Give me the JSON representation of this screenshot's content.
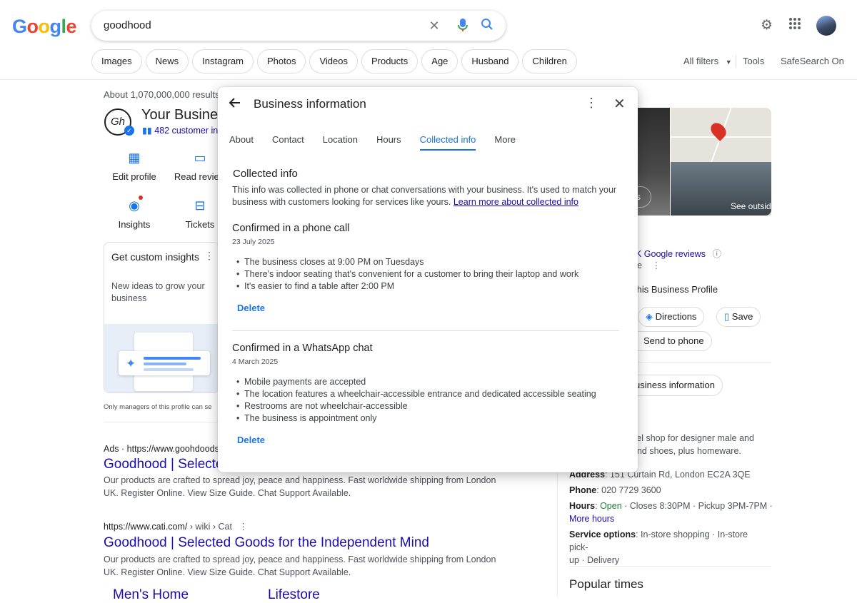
{
  "brand": {
    "logo": "Google",
    "colors": {
      "blue": "#4285F4",
      "red": "#EA4335",
      "yellow": "#FBBC05",
      "green": "#34A853",
      "link": "#1a0dab",
      "accent": "#1a73e8"
    }
  },
  "search": {
    "query": "goodhood"
  },
  "icons": {
    "clear": "close-icon",
    "voice": "mic-icon",
    "search": "search-icon",
    "settings": "gear-icon",
    "apps": "apps-grid-icon"
  },
  "filter_chips": [
    "Images",
    "News",
    "Instagram",
    "Photos",
    "Videos",
    "Products",
    "Age",
    "Husband",
    "Children"
  ],
  "header_tools": {
    "all_filters": "All filters",
    "tools": "Tools",
    "safesearch": "SafeSearch On"
  },
  "results_count": "About 1,070,000,000 results (0.",
  "business_profile": {
    "logo_text": "Gh",
    "title": "Your Busines",
    "interactions": "482 customer int",
    "actions": [
      {
        "label": "Edit profile",
        "icon": "store-icon"
      },
      {
        "label": "Read review",
        "icon": "review-icon"
      },
      {
        "label": "Insights",
        "icon": "insights-icon"
      },
      {
        "label": "Tickets",
        "icon": "ticket-icon"
      }
    ],
    "card": {
      "title": "Get custom insights",
      "subtitle": "New ideas to grow your business"
    },
    "managers_note": "Only managers of this profile can se"
  },
  "results": [
    {
      "url": "Ads · https://www.goohdoodst",
      "title": "Goodhood | Selected",
      "desc": "Our products are crafted to spread joy, peace and happiness. Fast worldwide shipping from London UK. Register Online. View Size Guide. Chat Support Available."
    },
    {
      "url": "https://www.cati.com/",
      "crumbs": "› wiki › Cat",
      "title": "Goodhood | Selected Goods for the Independent Mind",
      "desc": "Our products are crafted to spread joy, peace and happiness. Fast worldwide shipping from London UK. Register Online. View Size Guide. Chat Support Available."
    }
  ],
  "sitelinks": [
    "Men's Home",
    "Lifestore"
  ],
  "knowledge_panel": {
    "see_outside": "See outsid",
    "photos_label": "s",
    "title_frag": "d",
    "reviews": "K Google reviews",
    "category_frag": "re",
    "own_business": "this Business Profile",
    "buttons": {
      "directions": "Directions",
      "save": "Save",
      "send": "Send to phone",
      "info": "usiness information"
    },
    "description": "vel shop for designer male and\nand shoes, plus homeware.",
    "address_label": "Address",
    "address": "151 Curtain Rd, London EC2A 3QE",
    "phone_label": "Phone",
    "phone": "020 7729 3600",
    "hours_label": "Hours",
    "hours_status": "Open",
    "hours_detail": " · Closes 8:30PM · Pickup 3PM-7PM ·",
    "more_hours": "More hours",
    "service_label": "Service options",
    "service": "In-store shopping · In-store pick-\nup · Delivery",
    "popular_times": "Popular times"
  },
  "modal": {
    "title": "Business information",
    "tabs": [
      "About",
      "Contact",
      "Location",
      "Hours",
      "Collected info",
      "More"
    ],
    "active_tab": "Collected info",
    "heading": "Collected info",
    "intro": "This info was collected in phone or chat conversations with your business. It's used to match your business with customers looking for services like yours.",
    "learn_more": "Learn more about collected info",
    "sections": [
      {
        "title": "Confirmed in a phone call",
        "date": "23 July 2025",
        "items": [
          "The business closes at 9:00 PM on Tuesdays",
          "There's indoor seating that's convenient for a customer to bring their laptop and work",
          "It's easier to find a table after 2:00 PM"
        ],
        "delete": "Delete"
      },
      {
        "title": "Confirmed in a WhatsApp chat",
        "date": "4 March 2025",
        "items": [
          "Mobile payments are accepted",
          "The location features a wheelchair-accessible entrance and dedicated accessible seating",
          "Restrooms are not wheelchair-accessible",
          "The business is appointment only"
        ],
        "delete": "Delete"
      }
    ]
  }
}
